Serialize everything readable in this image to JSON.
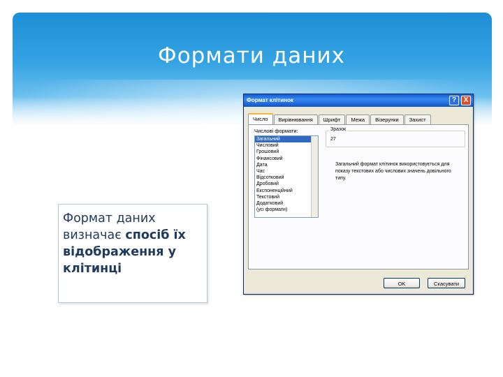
{
  "slide": {
    "title": "Формати даних",
    "text_box": {
      "part1": "Формат даних визначає ",
      "part2_bold": "спосіб їх відображення у клітинці"
    }
  },
  "dialog": {
    "title": "Формат клітинок",
    "help_label": "?",
    "close_label": "X",
    "tabs": [
      "Число",
      "Вирівнювання",
      "Шрифт",
      "Межа",
      "Візерунки",
      "Захист"
    ],
    "active_tab": "Число",
    "category_label": "Числові формати:",
    "categories": [
      "Загальний",
      "Числовий",
      "Грошовий",
      "Фінансовий",
      "Дата",
      "Час",
      "Відсотковий",
      "Дробовий",
      "Експоненційний",
      "Текстовий",
      "Додатковий",
      "(усі формати)"
    ],
    "selected_category": "Загальний",
    "sample_label": "Зразок",
    "sample_value": "27",
    "description": "Загальний формат клітинок використовується для показу текстових або числових значень довільного типу.",
    "ok_label": "OK",
    "cancel_label": "Скасувати"
  },
  "colors": {
    "header_blue": "#1d8fd6",
    "title_text": "#ffffff",
    "body_text": "#1f3a5c",
    "dialog_face": "#ece9d8",
    "selection": "#316ac5"
  }
}
